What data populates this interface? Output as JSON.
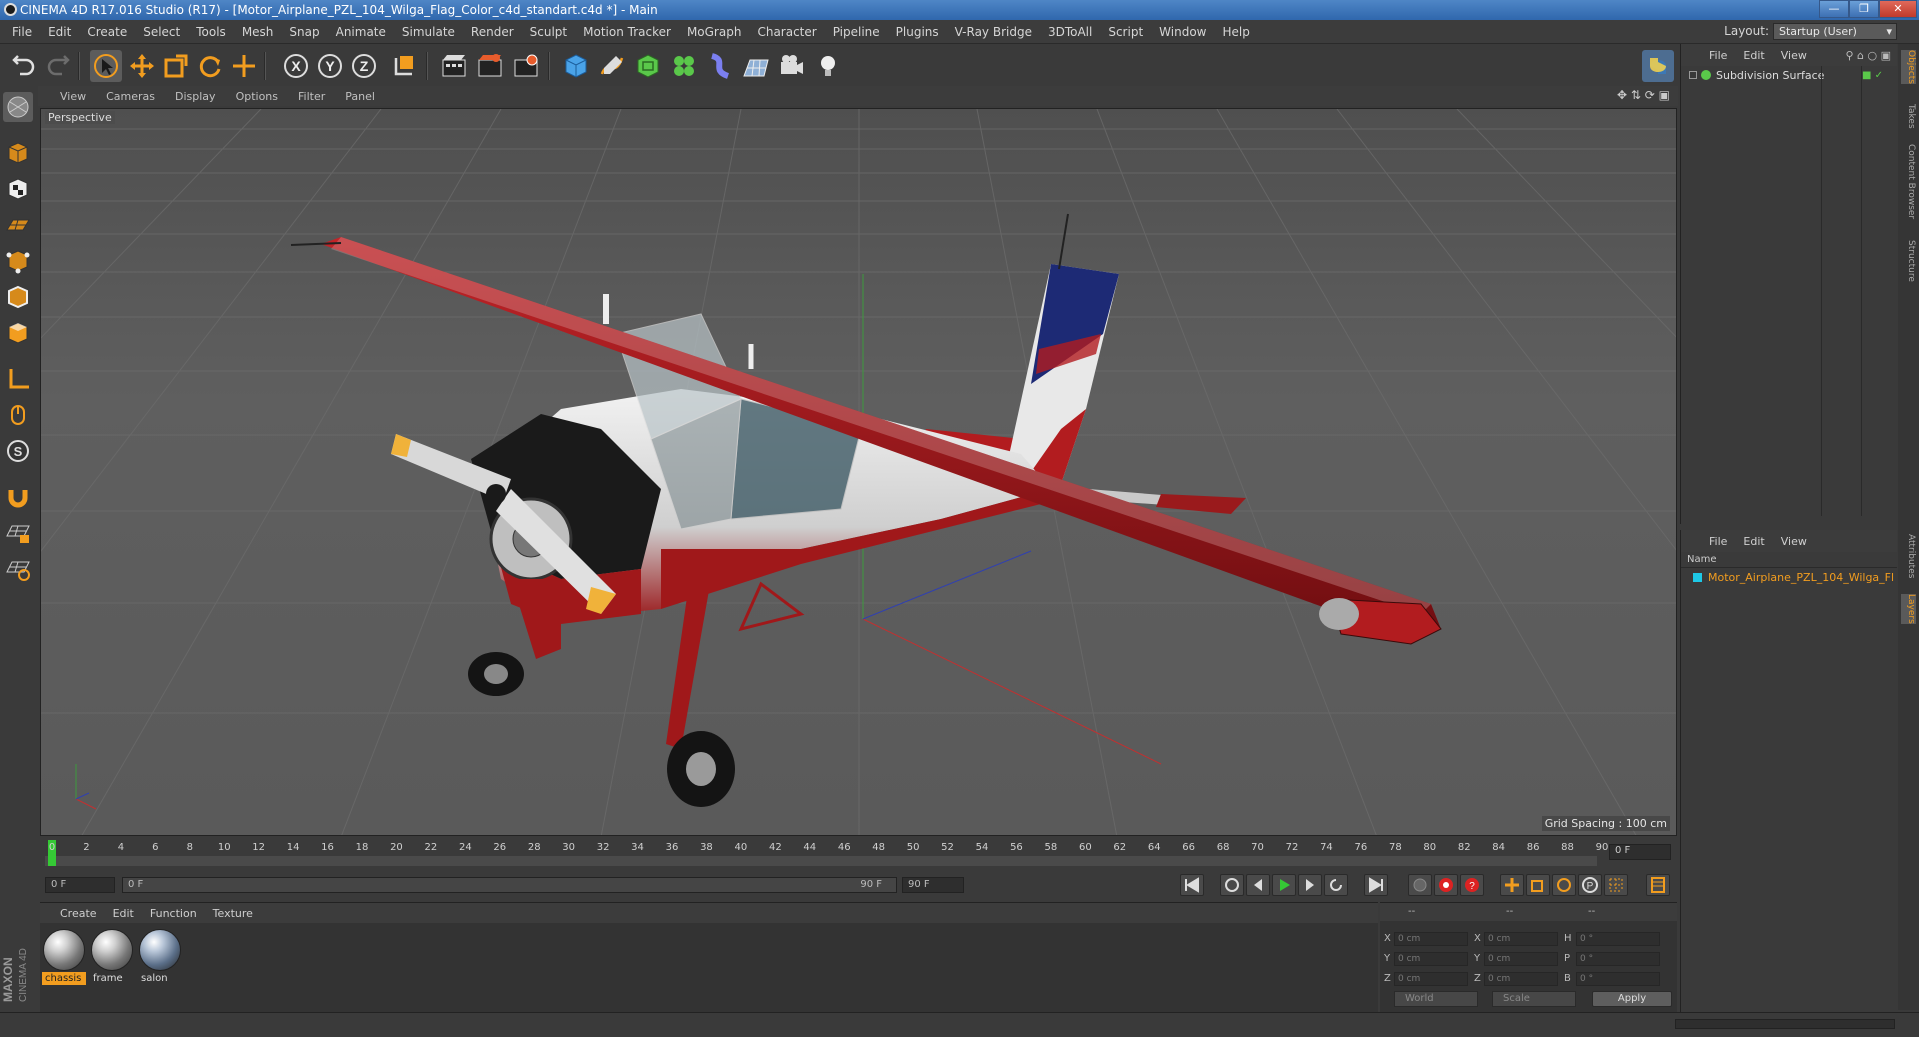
{
  "window": {
    "title": "CINEMA 4D R17.016 Studio (R17) - [Motor_Airplane_PZL_104_Wilga_Flag_Color_c4d_standart.c4d *] - Main"
  },
  "menu": [
    "File",
    "Edit",
    "Create",
    "Select",
    "Tools",
    "Mesh",
    "Snap",
    "Animate",
    "Simulate",
    "Render",
    "Sculpt",
    "Motion Tracker",
    "MoGraph",
    "Character",
    "Pipeline",
    "Plugins",
    "V-Ray Bridge",
    "3DToAll",
    "Script",
    "Window",
    "Help"
  ],
  "layout": {
    "label": "Layout:",
    "value": "Startup (User)"
  },
  "toolbar": {
    "icons": [
      "undo-icon",
      "redo-icon",
      "select-arrow-icon",
      "move-icon",
      "scale-icon",
      "rotate-icon",
      "transform-icon",
      "x-axis-icon",
      "y-axis-icon",
      "z-axis-icon",
      "world-coord-icon",
      "render-view-icon",
      "render-picture-queue-icon",
      "render-settings-icon",
      "cube-icon",
      "pen-spline-icon",
      "subdivision-icon",
      "cloner-icon",
      "deformer-icon",
      "floor-icon",
      "camera-icon",
      "light-icon"
    ]
  },
  "left_tools": [
    "model-mode-icon",
    "texture-mode-icon",
    "workplane-icon",
    "points-mode-icon",
    "edges-mode-icon",
    "polygons-mode-icon",
    "axis-icon",
    "tweak-icon",
    "snap-icon",
    "magnet-icon",
    "grid-lock-icon",
    "grid-snap-icon"
  ],
  "viewport": {
    "menu": [
      "View",
      "Cameras",
      "Display",
      "Options",
      "Filter",
      "Panel"
    ],
    "label": "Perspective",
    "grid_spacing": "Grid Spacing : 100 cm"
  },
  "timeline": {
    "ticks": [
      "0",
      "2",
      "4",
      "6",
      "8",
      "10",
      "12",
      "14",
      "16",
      "18",
      "20",
      "22",
      "24",
      "26",
      "28",
      "30",
      "32",
      "34",
      "36",
      "38",
      "40",
      "42",
      "44",
      "46",
      "48",
      "50",
      "52",
      "54",
      "56",
      "58",
      "60",
      "62",
      "64",
      "66",
      "68",
      "70",
      "72",
      "74",
      "76",
      "78",
      "80",
      "82",
      "84",
      "86",
      "88",
      "90"
    ],
    "current_frame": "0 F"
  },
  "playback": {
    "start": "0 F",
    "range_start": "0 F",
    "range_end": "90 F",
    "end": "90 F"
  },
  "materials": {
    "menu": [
      "Create",
      "Edit",
      "Function",
      "Texture"
    ],
    "items": [
      {
        "name": "chassis",
        "selected": true
      },
      {
        "name": "frame",
        "selected": false
      },
      {
        "name": "salon",
        "selected": false
      }
    ]
  },
  "coordinates": {
    "header": [
      "--",
      "--",
      "--"
    ],
    "rows": [
      {
        "l1": "X",
        "v1": "0 cm",
        "l2": "X",
        "v2": "0 cm",
        "l3": "H",
        "v3": "0 °"
      },
      {
        "l1": "Y",
        "v1": "0 cm",
        "l2": "Y",
        "v2": "0 cm",
        "l3": "P",
        "v3": "0 °"
      },
      {
        "l1": "Z",
        "v1": "0 cm",
        "l2": "Z",
        "v2": "0 cm",
        "l3": "B",
        "v3": "0 °"
      }
    ],
    "mode1": "World",
    "mode2": "Scale",
    "apply": "Apply"
  },
  "objects": {
    "menu": [
      "File",
      "Edit",
      "View"
    ],
    "items": [
      {
        "name": "Subdivision Surface"
      }
    ]
  },
  "layers": {
    "menu": [
      "File",
      "Edit",
      "View"
    ],
    "column": "Name",
    "items": [
      {
        "name": "Motor_Airplane_PZL_104_Wilga_Fl",
        "color": "#1ec8e6"
      }
    ]
  },
  "side_tabs": {
    "top": [
      "Objects",
      "Takes",
      "Content Browser",
      "Structure"
    ],
    "bottom": [
      "Attributes",
      "Layers"
    ]
  },
  "brand": {
    "logo_text_1": "MAXON",
    "logo_text_2": "CINEMA 4D"
  },
  "colors": {
    "accent": "#f29d1f",
    "plane_red": "#a0181a",
    "sky_blue": "#1d2a75"
  }
}
